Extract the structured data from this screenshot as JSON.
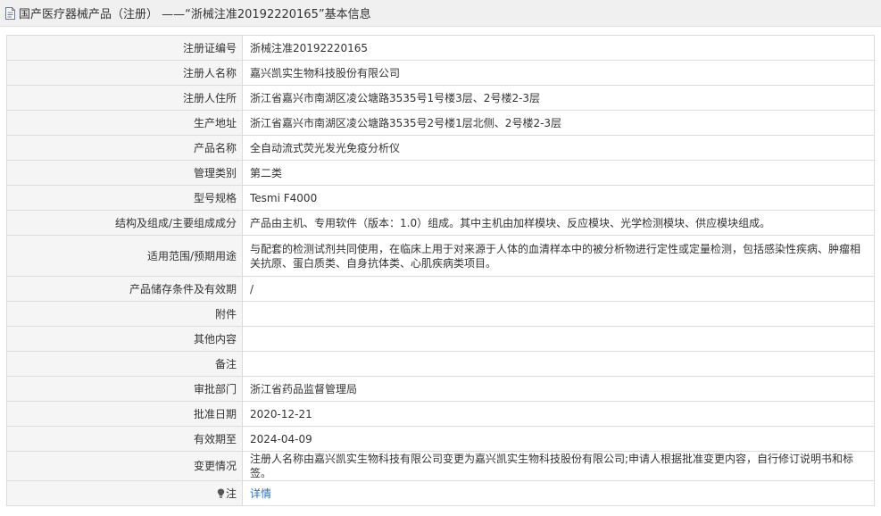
{
  "header": {
    "title": "国产医疗器械产品（注册） ——“浙械注准20192220165”基本信息"
  },
  "rows": [
    {
      "label": "注册证编号",
      "value": "浙械注准20192220165"
    },
    {
      "label": "注册人名称",
      "value": "嘉兴凯实生物科技股份有限公司"
    },
    {
      "label": "注册人住所",
      "value": "浙江省嘉兴市南湖区凌公塘路3535号1号楼3层、2号楼2-3层"
    },
    {
      "label": "生产地址",
      "value": "浙江省嘉兴市南湖区凌公塘路3535号2号楼1层北侧、2号楼2-3层"
    },
    {
      "label": "产品名称",
      "value": "全自动流式荧光发光免疫分析仪"
    },
    {
      "label": "管理类别",
      "value": "第二类"
    },
    {
      "label": "型号规格",
      "value": "Tesmi F4000"
    },
    {
      "label": "结构及组成/主要组成成分",
      "value": "产品由主机、专用软件（版本：1.0）组成。其中主机由加样模块、反应模块、光学检测模块、供应模块组成。"
    },
    {
      "label": "适用范围/预期用途",
      "value": "与配套的检测试剂共同使用，在临床上用于对来源于人体的血清样本中的被分析物进行定性或定量检测，包括感染性疾病、肿瘤相关抗原、蛋白质类、自身抗体类、心肌疾病类项目。"
    },
    {
      "label": "产品储存条件及有效期",
      "value": "/"
    },
    {
      "label": "附件",
      "value": ""
    },
    {
      "label": "其他内容",
      "value": ""
    },
    {
      "label": "备注",
      "value": ""
    },
    {
      "label": "审批部门",
      "value": "浙江省药品监督管理局"
    },
    {
      "label": "批准日期",
      "value": "2020-12-21"
    },
    {
      "label": "有效期至",
      "value": "2024-04-09"
    },
    {
      "label": "变更情况",
      "value": "注册人名称由嘉兴凯实生物科技有限公司变更为嘉兴凯实生物科技股份有限公司;申请人根据批准变更内容，自行修订说明书和标签。"
    }
  ],
  "note": {
    "label": "注",
    "link_text": "详情",
    "icon": "lightbulb-icon"
  },
  "colors": {
    "header_bg": "#f0f0f0",
    "label_bg": "#f5f5f5",
    "border": "#dcdcdc",
    "link": "#2d6fc1"
  }
}
